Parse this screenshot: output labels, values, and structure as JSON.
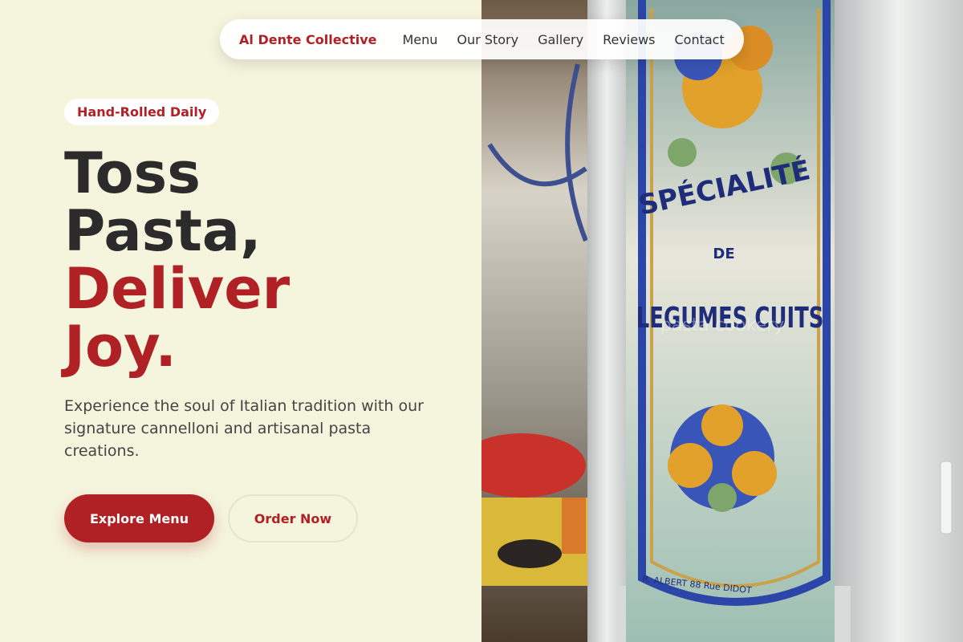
{
  "nav": {
    "brand": "Al Dente Collective",
    "links": [
      "Menu",
      "Our Story",
      "Gallery",
      "Reviews",
      "Contact"
    ]
  },
  "hero": {
    "badge": "Hand-Rolled Daily",
    "headline": {
      "line1": "Toss",
      "line2": "Pasta,",
      "line3": "Deliver",
      "line4": "Joy."
    },
    "lead": "Experience the soul of Italian tradition with our signature cannelloni and artisanal pasta creations.",
    "primary_button": "Explore Menu",
    "secondary_button": "Order Now"
  },
  "photo": {
    "sign_line1": "SPÉCIALITÉ",
    "sign_line2": "DE",
    "sign_line3": "LEGUMES CUITS",
    "sign_credit": "R. ALBERT 88 Rue DIDOT",
    "watermark": "pasta cookery"
  },
  "colors": {
    "accent": "#b02126",
    "background": "#f5f4dd",
    "text": "#2b2b2b"
  }
}
